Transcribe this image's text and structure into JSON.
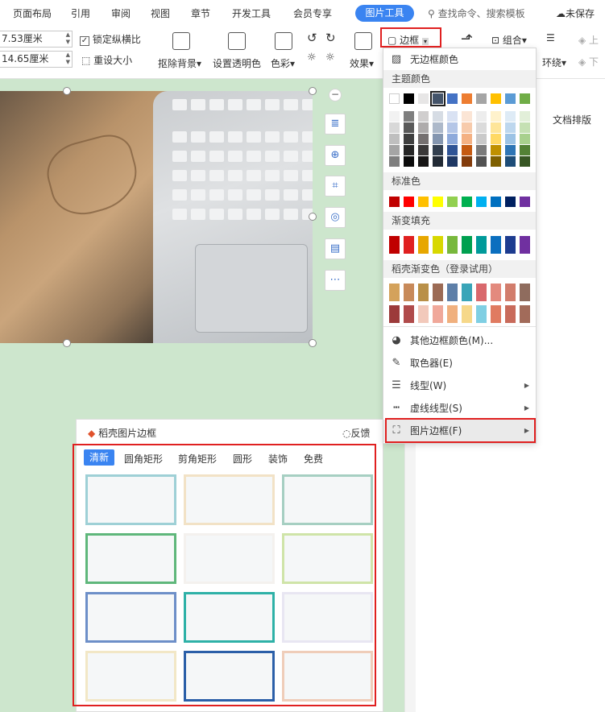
{
  "tabs": [
    {
      "label": "页面布局"
    },
    {
      "label": "引用"
    },
    {
      "label": "审阅"
    },
    {
      "label": "视图"
    },
    {
      "label": "章节"
    },
    {
      "label": "开发工具"
    },
    {
      "label": "会员专享"
    }
  ],
  "active_tab": "图片工具",
  "search_label": "查找命令、搜索模板",
  "unsaved_label": "未保存",
  "toolbar": {
    "width_value": "7.53厘米",
    "height_value": "14.65厘米",
    "lock_ratio": "锁定纵横比",
    "lock_checked": true,
    "reset_size": "重设大小",
    "remove_bg": "抠除背景",
    "set_transparent": "设置透明色",
    "color": "色彩",
    "effects": "效果",
    "border": "边框",
    "group": "组合",
    "wrap": "环绕",
    "up": "上",
    "down": "下"
  },
  "right_pane": {
    "doc_layout": "文档排版"
  },
  "dropdown": {
    "no_border_color": "无边框颜色",
    "theme_colors_label": "主题颜色",
    "theme_top": [
      "#ffffff",
      "#000000",
      "#e7e6e6",
      "#44546a",
      "#4472c4",
      "#ed7d31",
      "#a5a5a5",
      "#ffc000",
      "#5b9bd5",
      "#70ad47"
    ],
    "theme_shades": [
      [
        "#f2f2f2",
        "#7f7f7f",
        "#d0cece",
        "#d6dce4",
        "#d9e2f3",
        "#fbe5d5",
        "#ededed",
        "#fff2cc",
        "#deebf6",
        "#e2efd9"
      ],
      [
        "#d8d8d8",
        "#595959",
        "#aeabab",
        "#adb9ca",
        "#b4c6e7",
        "#f7cbac",
        "#dbdbdb",
        "#fee599",
        "#bdd7ee",
        "#c5e0b3"
      ],
      [
        "#bfbfbf",
        "#3f3f3f",
        "#757070",
        "#8496b0",
        "#8eaadb",
        "#f4b183",
        "#c9c9c9",
        "#ffd965",
        "#9cc3e5",
        "#a8d08d"
      ],
      [
        "#a5a5a5",
        "#262626",
        "#3a3838",
        "#323f4f",
        "#2f5496",
        "#c55a11",
        "#7b7b7b",
        "#bf9000",
        "#2e75b5",
        "#538135"
      ],
      [
        "#7f7f7f",
        "#0c0c0c",
        "#171616",
        "#222a35",
        "#1f3864",
        "#833c0b",
        "#525252",
        "#7f6000",
        "#1e4d78",
        "#375623"
      ]
    ],
    "standard_label": "标准色",
    "standard": [
      "#c00000",
      "#ff0000",
      "#ffc000",
      "#ffff00",
      "#92d050",
      "#00b050",
      "#00b0f0",
      "#0070c0",
      "#002060",
      "#7030a0"
    ],
    "gradient_label": "渐变填充",
    "gradient": [
      "#c00000",
      "#e02020",
      "#e7a700",
      "#d8d800",
      "#78b83c",
      "#00a050",
      "#009a9a",
      "#0b6fbf",
      "#1d3c8f",
      "#7030a0"
    ],
    "daoke_label": "稻壳渐变色（登录试用）",
    "daoke_row1": [
      "#d4a25b",
      "#c88a5a",
      "#b99048",
      "#9c6b55",
      "#5e7fa8",
      "#3aa5b8",
      "#d9696d",
      "#e38a7e",
      "#d27d6c",
      "#8f6c5e"
    ],
    "daoke_row2": [
      "#9c3a3a",
      "#b04b4b",
      "#f2c9bb",
      "#f0a89a",
      "#f0b07e",
      "#f6d88a",
      "#7fcfe3",
      "#e07b61",
      "#c96b5b",
      "#a26b5a"
    ],
    "more_colors": "其他边框颜色(M)...",
    "eyedropper": "取色器(E)",
    "line_type": "线型(W)",
    "dash_type": "虚线线型(S)",
    "picture_frame": "图片边框(F)"
  },
  "frames_panel": {
    "title": "稻壳图片边框",
    "feedback": "反馈",
    "tabs": [
      {
        "label": "清新"
      },
      {
        "label": "圆角矩形"
      },
      {
        "label": "剪角矩形"
      },
      {
        "label": "圆形"
      },
      {
        "label": "装饰"
      },
      {
        "label": "免费"
      }
    ],
    "frame_colors": [
      "#9ed0d6",
      "#f2e2c6",
      "#a6cfc2",
      "#5fb77b",
      "#f4f1ee",
      "#cfe4a8",
      "#6d8fc8",
      "#2eb1a7",
      "#e8e6f2",
      "#f2e7c6",
      "#2b5fa8",
      "#efcdb9"
    ]
  }
}
